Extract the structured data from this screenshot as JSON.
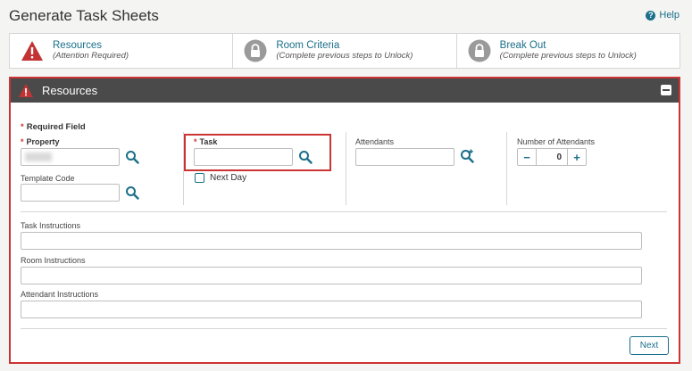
{
  "page": {
    "title": "Generate Task Sheets",
    "help_label": "Help"
  },
  "steps": [
    {
      "title": "Resources",
      "subtitle": "(Attention Required)"
    },
    {
      "title": "Room Criteria",
      "subtitle": "(Complete previous steps to Unlock)"
    },
    {
      "title": "Break Out",
      "subtitle": "(Complete previous steps to Unlock)"
    }
  ],
  "panel": {
    "title": "Resources"
  },
  "form": {
    "required_note": "Required Field",
    "property": {
      "label": "Property",
      "value": ""
    },
    "template_code": {
      "label": "Template Code",
      "value": ""
    },
    "task": {
      "label": "Task",
      "value": ""
    },
    "next_day": {
      "label": "Next Day",
      "checked": false
    },
    "attendants": {
      "label": "Attendants",
      "value": ""
    },
    "number_of_attendants": {
      "label": "Number of Attendants",
      "value": "0"
    },
    "task_instructions": {
      "label": "Task Instructions",
      "value": ""
    },
    "room_instructions": {
      "label": "Room Instructions",
      "value": ""
    },
    "attendant_instructions": {
      "label": "Attendant Instructions",
      "value": ""
    },
    "next_button": "Next",
    "stepper_minus": "−",
    "stepper_plus": "+"
  },
  "colors": {
    "accent": "#1a6f8a",
    "warning": "#c33333",
    "header": "#4a4a4a",
    "locked": "#9a9a9a"
  }
}
